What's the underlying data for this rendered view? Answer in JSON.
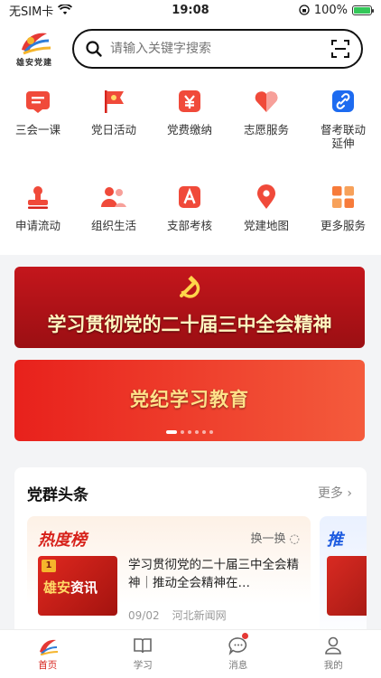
{
  "status_bar": {
    "carrier": "无SIM卡",
    "time": "19:08",
    "battery": "100%",
    "battery_level": 1.0
  },
  "header": {
    "logo_text": "雄安党建",
    "search_placeholder": "请输入关键字搜索"
  },
  "grid": {
    "items": [
      {
        "label": "三会一课",
        "icon": "meeting-icon"
      },
      {
        "label": "党日活动",
        "icon": "flag-icon"
      },
      {
        "label": "党费缴纳",
        "icon": "yuan-icon"
      },
      {
        "label": "志愿服务",
        "icon": "heart-icon"
      },
      {
        "label": "督考联动延伸",
        "icon": "link-icon"
      },
      {
        "label": "申请流动",
        "icon": "stamp-icon"
      },
      {
        "label": "组织生活",
        "icon": "group-icon"
      },
      {
        "label": "支部考核",
        "icon": "grade-icon"
      },
      {
        "label": "党建地图",
        "icon": "map-pin-icon"
      },
      {
        "label": "更多服务",
        "icon": "more-grid-icon"
      }
    ]
  },
  "banners": [
    {
      "title": "学习贯彻党的二十届三中全会精神"
    },
    {
      "title": "党纪学习教育"
    }
  ],
  "news": {
    "title": "党群头条",
    "more": "更多",
    "hot": {
      "title": "热度榜",
      "refresh": "换一换",
      "thumb_rank": "1",
      "thumb_text_a": "雄安",
      "thumb_text_b": "资讯",
      "article_title": "学习贯彻党的二十届三中全会精神｜推动全会精神在…",
      "date": "09/02",
      "source": "河北新闻网"
    },
    "side_title": "推"
  },
  "tabbar": {
    "items": [
      {
        "label": "首页"
      },
      {
        "label": "学习"
      },
      {
        "label": "消息"
      },
      {
        "label": "我的"
      }
    ]
  },
  "colors": {
    "accent": "#d7231c",
    "blue": "#1d6bf0"
  }
}
